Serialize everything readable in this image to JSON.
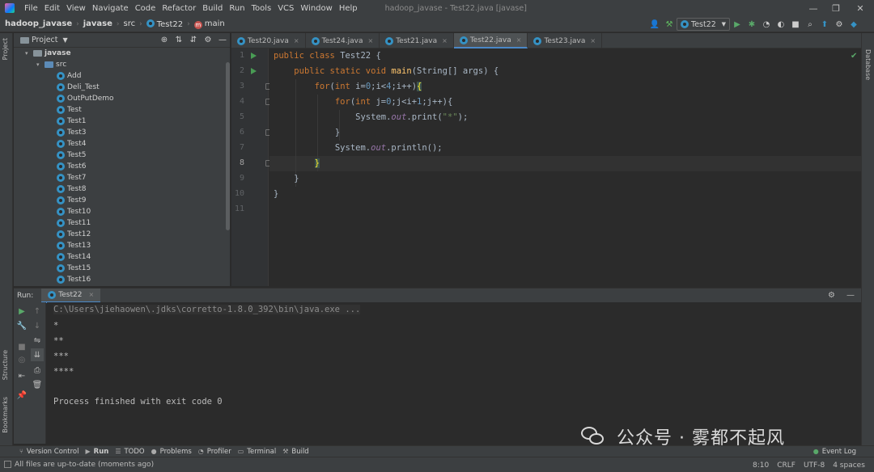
{
  "window": {
    "title": "hadoop_javase - Test22.java [javase]",
    "controls": {
      "minimize": "—",
      "restore": "❐",
      "close": "✕"
    }
  },
  "menu": [
    "File",
    "Edit",
    "View",
    "Navigate",
    "Code",
    "Refactor",
    "Build",
    "Run",
    "Tools",
    "VCS",
    "Window",
    "Help"
  ],
  "breadcrumb": [
    "hadoop_javase",
    "javase",
    "src",
    "Test22",
    "main"
  ],
  "run_config": "Test22",
  "project_panel": {
    "title": "Project",
    "module": "javase",
    "src_folder": "src",
    "classes": [
      "Add",
      "Deli_Test",
      "OutPutDemo",
      "Test",
      "Test1",
      "Test3",
      "Test4",
      "Test5",
      "Test6",
      "Test7",
      "Test8",
      "Test9",
      "Test10",
      "Test11",
      "Test12",
      "Test13",
      "Test14",
      "Test15",
      "Test16"
    ]
  },
  "editor": {
    "tabs": [
      {
        "label": "Test20.java",
        "active": false
      },
      {
        "label": "Test24.java",
        "active": false
      },
      {
        "label": "Test21.java",
        "active": false
      },
      {
        "label": "Test22.java",
        "active": true
      },
      {
        "label": "Test23.java",
        "active": false
      }
    ],
    "line_numbers": [
      "1",
      "2",
      "3",
      "4",
      "5",
      "6",
      "7",
      "8",
      "9",
      "10",
      "11"
    ],
    "current_line": "8",
    "code": {
      "l1": {
        "kw": "public class ",
        "name": "Test22 {"
      },
      "l2": {
        "kw1": "public static void ",
        "fn": "main",
        "rest": "(String[] args) {"
      },
      "l3": {
        "kw": "for",
        "p1": "(",
        "kw2": "int",
        "p2": " i=",
        "n1": "0",
        "p3": ";i<",
        "n2": "4",
        "p4": ";i++)",
        "br": "{"
      },
      "l4": {
        "kw": "for",
        "p1": "(",
        "kw2": "int",
        "p2": " j=",
        "n1": "0",
        "p3": ";j<i+",
        "n2": "1",
        "p4": ";j++){"
      },
      "l5": {
        "p1": "System.",
        "f": "out",
        "p2": ".print(",
        "s": "\"*\"",
        "p3": ");"
      },
      "l6": "}",
      "l7": {
        "p1": "System.",
        "f": "out",
        "p2": ".println();"
      },
      "l8": "}",
      "l9": "}",
      "l10": "}"
    }
  },
  "run_panel": {
    "label": "Run:",
    "tab": "Test22",
    "command": "C:\\Users\\jiehaowen\\.jdks\\corretto-1.8.0_392\\bin\\java.exe ...",
    "output": [
      "*",
      "**",
      "***",
      "****"
    ],
    "exit": "Process finished with exit code 0"
  },
  "bottom_tools": [
    "Version Control",
    "Run",
    "TODO",
    "Problems",
    "Profiler",
    "Terminal",
    "Build"
  ],
  "event_log": "Event Log",
  "side_tabs": {
    "project": "Project",
    "structure": "Structure",
    "bookmarks": "Bookmarks",
    "database": "Database"
  },
  "status": {
    "message": "All files are up-to-date (moments ago)",
    "position": "8:10",
    "line_sep": "CRLF",
    "encoding": "UTF-8",
    "indent": "4 spaces"
  },
  "watermark": "公众号 · 雾都不起风",
  "colors": {
    "keyword": "#cc7832",
    "function": "#ffc66d",
    "number": "#6897bb",
    "string": "#6a8759",
    "field": "#9876aa",
    "accent": "#4a88c7",
    "run": "#499c54"
  }
}
